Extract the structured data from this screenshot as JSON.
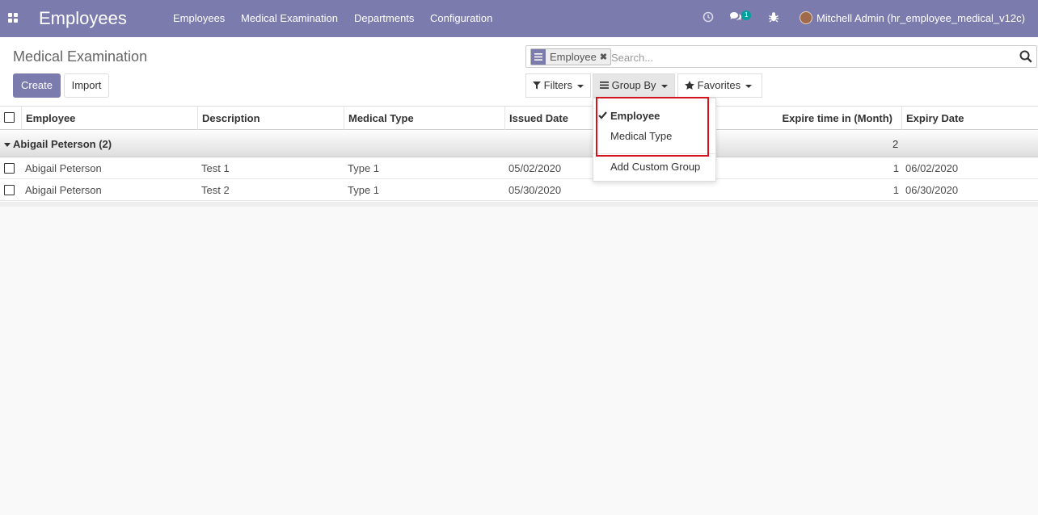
{
  "navbar": {
    "brand": "Employees",
    "menu": [
      "Employees",
      "Medical Examination",
      "Departments",
      "Configuration"
    ],
    "message_count": "1",
    "user": "Mitchell Admin (hr_employee_medical_v12c)",
    "colors": {
      "bar": "#7c7bad",
      "badge": "#00a09d"
    }
  },
  "control_panel": {
    "title": "Medical Examination",
    "create_label": "Create",
    "import_label": "Import",
    "search": {
      "facet_value": "Employee",
      "placeholder": "Search..."
    },
    "filters_label": "Filters",
    "groupby_label": "Group By",
    "favorites_label": "Favorites"
  },
  "groupby_dropdown": {
    "items": [
      {
        "label": "Employee",
        "checked": true
      },
      {
        "label": "Medical Type",
        "checked": false
      }
    ],
    "custom_label": "Add Custom Group"
  },
  "table": {
    "columns": [
      "Employee",
      "Description",
      "Medical Type",
      "Issued Date",
      "Expire time in (Month)",
      "Expiry Date"
    ],
    "groups": [
      {
        "label": "Abigail Peterson (2)",
        "count": "2",
        "rows": [
          {
            "employee": "Abigail Peterson",
            "description": "Test 1",
            "medical_type": "Type 1",
            "issued": "05/02/2020",
            "months": "1",
            "expiry": "06/02/2020"
          },
          {
            "employee": "Abigail Peterson",
            "description": "Test 2",
            "medical_type": "Type 1",
            "issued": "05/30/2020",
            "months": "1",
            "expiry": "06/30/2020"
          }
        ]
      }
    ]
  }
}
